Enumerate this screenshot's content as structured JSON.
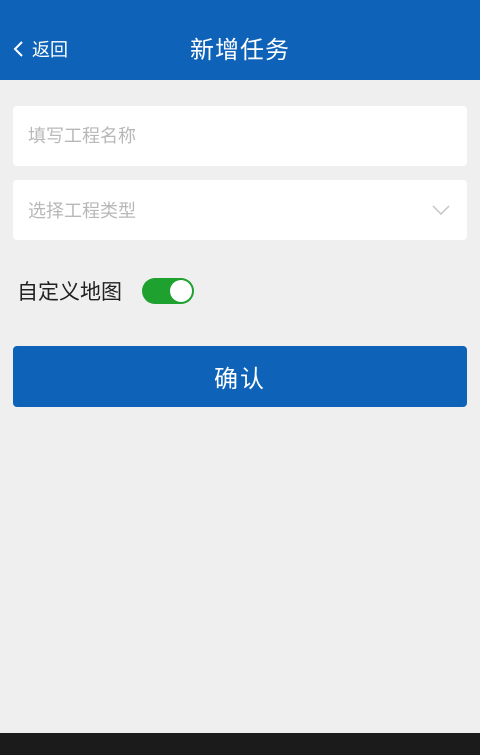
{
  "header": {
    "back_label": "返回",
    "title": "新增任务",
    "back_icon": "chevron-left-icon"
  },
  "form": {
    "name_placeholder": "填写工程名称",
    "type_placeholder": "选择工程类型",
    "type_dropdown_icon": "chevron-down-icon",
    "custom_map_label": "自定义地图",
    "custom_map_enabled": true,
    "confirm_label": "确认"
  },
  "colors": {
    "primary": "#0e63b8",
    "toggle_on": "#1ea12e",
    "background": "#efefef"
  }
}
